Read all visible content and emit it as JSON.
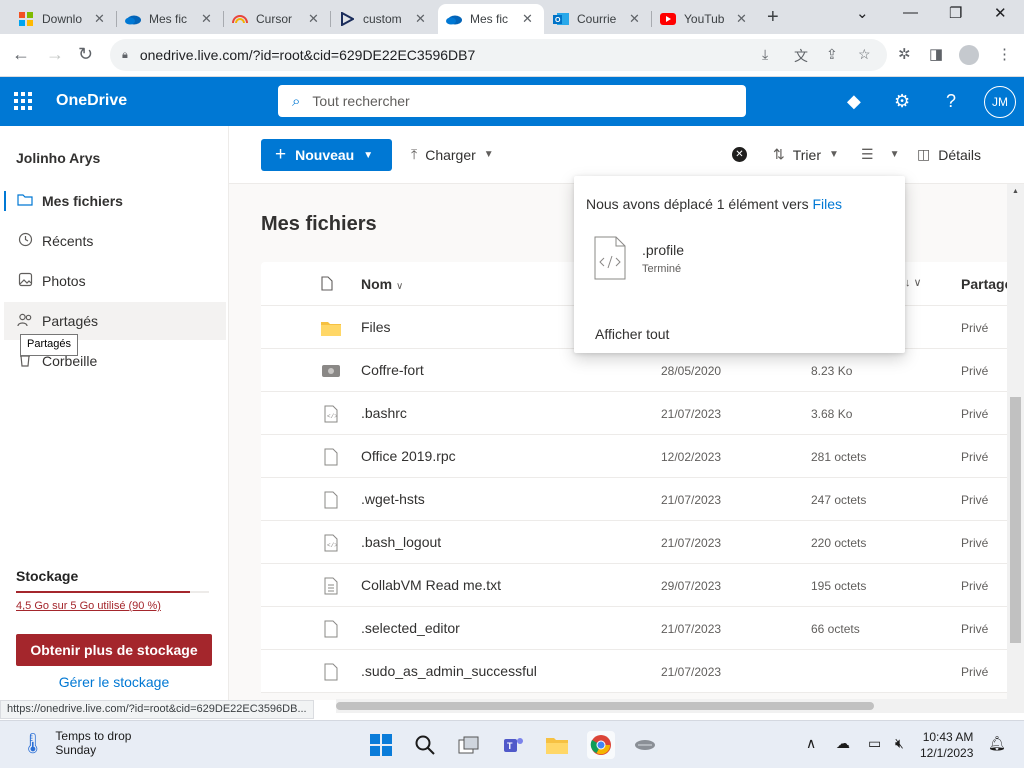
{
  "browser": {
    "tabs": [
      {
        "title": "Downlo",
        "icon": "microsoft-icon"
      },
      {
        "title": "Mes fic",
        "icon": "onedrive-icon"
      },
      {
        "title": "Cursor",
        "icon": "cursor-icon"
      },
      {
        "title": "custom",
        "icon": "play-icon"
      },
      {
        "title": "Mes fic",
        "icon": "onedrive-icon"
      },
      {
        "title": "Courrie",
        "icon": "outlook-icon"
      },
      {
        "title": "YouTub",
        "icon": "youtube-icon"
      }
    ],
    "active_tab_index": 4,
    "url": "onedrive.live.com/?id=root&cid=629DE22EC3596DB7",
    "status_url": "https://onedrive.live.com/?id=root&cid=629DE22EC3596DB..."
  },
  "app": {
    "brand": "OneDrive",
    "search_placeholder": "Tout rechercher",
    "avatar_initials": "JM",
    "accent_color": "#0078d4"
  },
  "nav": {
    "user_name": "Jolinho Arys",
    "items": [
      {
        "label": "Mes fichiers",
        "icon": "folder-icon"
      },
      {
        "label": "Récents",
        "icon": "clock-icon"
      },
      {
        "label": "Photos",
        "icon": "image-icon"
      },
      {
        "label": "Partagés",
        "icon": "people-icon"
      },
      {
        "label": "Corbeille",
        "icon": "trash-icon"
      }
    ],
    "selected_index": 0,
    "tooltip": "Partagés"
  },
  "storage": {
    "title": "Stockage",
    "usage_text": "4,5 Go sur 5 Go utilisé (90 %)",
    "used_fraction": 0.9,
    "buy_button": "Obtenir plus de stockage",
    "manage_link": "Gérer le stockage",
    "warning_color": "#a4262c"
  },
  "toolbar": {
    "new_label": "Nouveau",
    "upload_label": "Charger",
    "sort_label": "Trier",
    "details_label": "Détails"
  },
  "main": {
    "title": "Mes fichiers",
    "columns": {
      "name": "Nom",
      "sharing": "Partage"
    },
    "files": [
      {
        "name": "Files",
        "date": "",
        "size": "",
        "sharing": "Privé",
        "type": "folder"
      },
      {
        "name": "Coffre-fort",
        "date": "28/05/2020",
        "size": "8.23 Ko",
        "sharing": "Privé",
        "type": "vault"
      },
      {
        "name": ".bashrc",
        "date": "21/07/2023",
        "size": "3.68 Ko",
        "sharing": "Privé",
        "type": "code"
      },
      {
        "name": "Office 2019.rpc",
        "date": "12/02/2023",
        "size": "281 octets",
        "sharing": "Privé",
        "type": "file"
      },
      {
        "name": ".wget-hsts",
        "date": "21/07/2023",
        "size": "247 octets",
        "sharing": "Privé",
        "type": "file"
      },
      {
        "name": ".bash_logout",
        "date": "21/07/2023",
        "size": "220 octets",
        "sharing": "Privé",
        "type": "code"
      },
      {
        "name": "CollabVM Read me.txt",
        "date": "29/07/2023",
        "size": "195 octets",
        "sharing": "Privé",
        "type": "text"
      },
      {
        "name": ".selected_editor",
        "date": "21/07/2023",
        "size": "66 octets",
        "sharing": "Privé",
        "type": "file"
      },
      {
        "name": ".sudo_as_admin_successful",
        "date": "21/07/2023",
        "size": "",
        "sharing": "Privé",
        "type": "file"
      }
    ]
  },
  "notification": {
    "message": "Nous avons déplacé 1 élément vers ",
    "link": "Files",
    "item_name": ".profile",
    "item_status": "Terminé",
    "see_all": "Afficher tout"
  },
  "taskbar": {
    "weather_line1": "Temps to drop",
    "weather_line2": "Sunday",
    "time": "10:43 AM",
    "date": "12/1/2023"
  }
}
